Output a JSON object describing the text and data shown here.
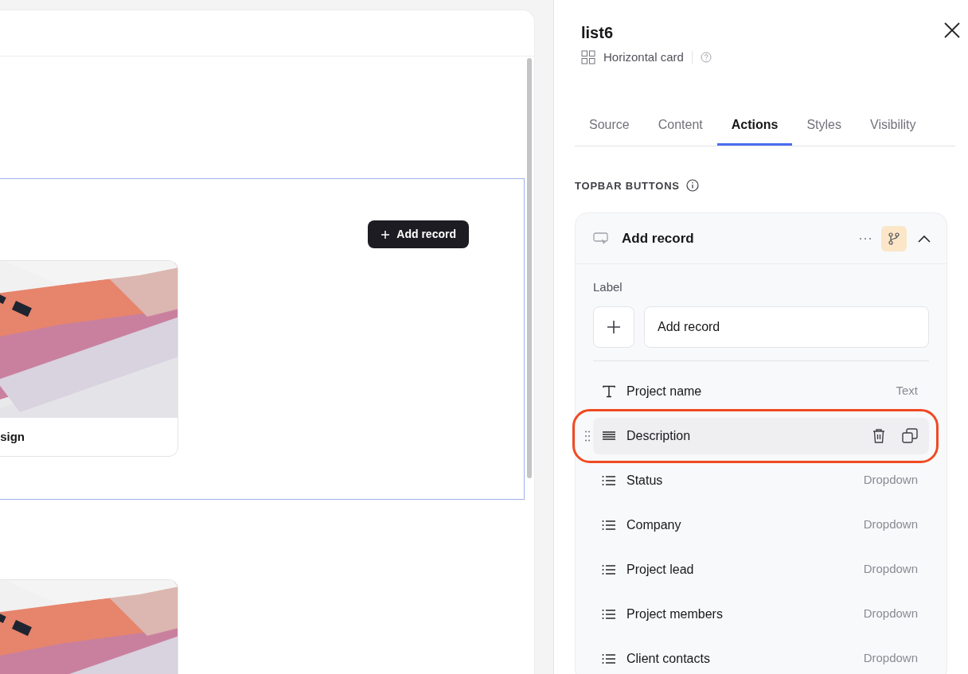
{
  "canvas": {
    "add_button": {
      "label": "Add record"
    },
    "cards": [
      {
        "kind": "picture",
        "title": "sign"
      },
      {
        "kind": "picture"
      }
    ]
  },
  "panel": {
    "title": "list6",
    "component_type": "Horizontal card",
    "tabs": [
      {
        "label": "Source",
        "selected": false
      },
      {
        "label": "Content",
        "selected": false
      },
      {
        "label": "Actions",
        "selected": true
      },
      {
        "label": "Styles",
        "selected": false
      },
      {
        "label": "Visibility",
        "selected": false
      }
    ],
    "section_title": "TOPBAR BUTTONS",
    "action": {
      "title": "Add record",
      "expanded": true,
      "label_caption": "Label",
      "label_value": "Add record",
      "fields": [
        {
          "kind": "text",
          "name": "Project name",
          "type": "Text",
          "selected": false
        },
        {
          "kind": "long-text",
          "name": "Description",
          "selected": true
        },
        {
          "kind": "dropdown",
          "name": "Status",
          "type": "Dropdown",
          "selected": false
        },
        {
          "kind": "dropdown",
          "name": "Company",
          "type": "Dropdown",
          "selected": false
        },
        {
          "kind": "dropdown",
          "name": "Project lead",
          "type": "Dropdown",
          "selected": false
        },
        {
          "kind": "dropdown",
          "name": "Project members",
          "type": "Dropdown",
          "selected": false
        },
        {
          "kind": "dropdown",
          "name": "Client contacts",
          "type": "Dropdown",
          "selected": false
        }
      ]
    }
  }
}
